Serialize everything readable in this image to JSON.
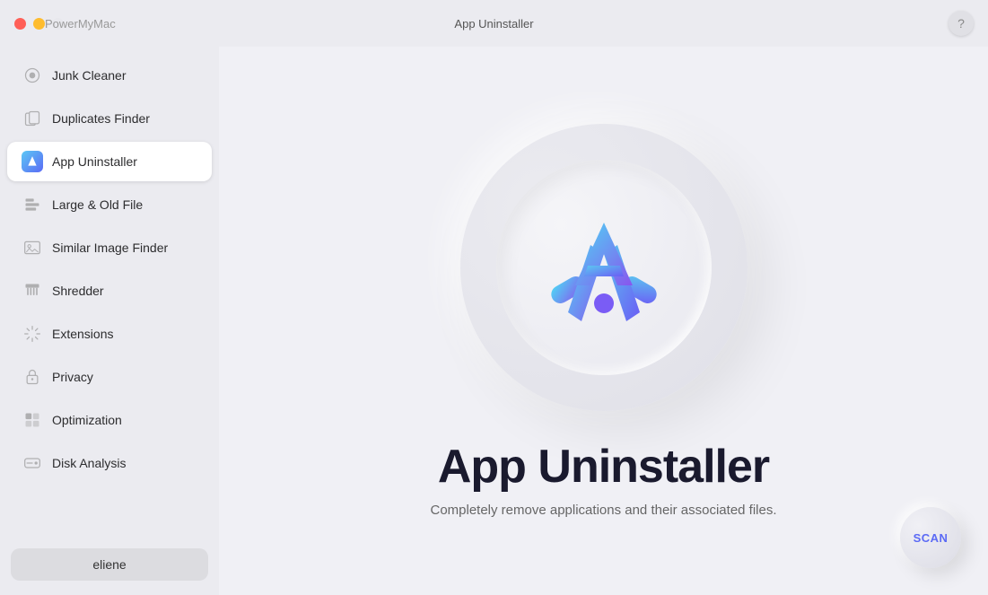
{
  "titleBar": {
    "appName": "PowerMyMac",
    "windowTitle": "App Uninstaller",
    "helpLabel": "?"
  },
  "sidebar": {
    "items": [
      {
        "id": "junk-cleaner",
        "label": "Junk Cleaner",
        "active": false,
        "icon": "gear"
      },
      {
        "id": "duplicates-finder",
        "label": "Duplicates Finder",
        "active": false,
        "icon": "folder"
      },
      {
        "id": "app-uninstaller",
        "label": "App Uninstaller",
        "active": true,
        "icon": "app"
      },
      {
        "id": "large-old-file",
        "label": "Large & Old File",
        "active": false,
        "icon": "briefcase"
      },
      {
        "id": "similar-image-finder",
        "label": "Similar Image Finder",
        "active": false,
        "icon": "image"
      },
      {
        "id": "shredder",
        "label": "Shredder",
        "active": false,
        "icon": "shredder"
      },
      {
        "id": "extensions",
        "label": "Extensions",
        "active": false,
        "icon": "extensions"
      },
      {
        "id": "privacy",
        "label": "Privacy",
        "active": false,
        "icon": "lock"
      },
      {
        "id": "optimization",
        "label": "Optimization",
        "active": false,
        "icon": "optimization"
      },
      {
        "id": "disk-analysis",
        "label": "Disk Analysis",
        "active": false,
        "icon": "disk"
      }
    ],
    "user": {
      "name": "eliene"
    }
  },
  "content": {
    "featureTitle": "App Uninstaller",
    "featureDesc": "Completely remove applications and their associated files.",
    "scanButton": "SCAN"
  }
}
